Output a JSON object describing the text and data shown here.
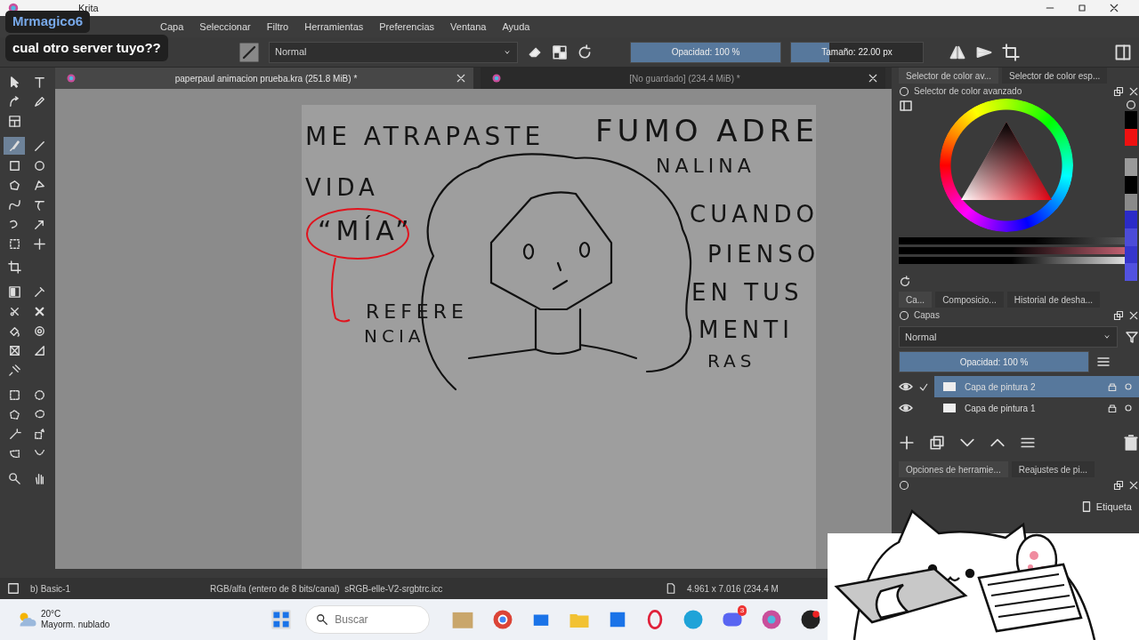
{
  "window": {
    "title": "Krita"
  },
  "chat_overlay": {
    "user": "Mrmagico6",
    "message": "cual otro server tuyo??"
  },
  "menu": [
    "Capa",
    "Seleccionar",
    "Filtro",
    "Herramientas",
    "Preferencias",
    "Ventana",
    "Ayuda"
  ],
  "toolbar": {
    "blend_mode": "Normal",
    "opacity": {
      "label": "Opacidad: 100 %",
      "level": 1
    },
    "size": {
      "label": "Tamaño: 22.00 px",
      "level": 0.29
    }
  },
  "document_tabs": [
    {
      "title": "paperpaul animacion prueba.kra (251.8 MiB) *",
      "selected": true
    },
    {
      "title": "[No guardado] (234.4 MiB) *",
      "selected": false
    }
  ],
  "toolbox": [
    {
      "selected": false
    },
    {
      "selected": false
    },
    {
      "selected": false
    },
    {
      "selected": false
    },
    {
      "selected": false
    },
    {
      "selected": true
    },
    {
      "selected": false
    },
    {
      "selected": false
    },
    {
      "selected": false
    },
    {
      "selected": false
    },
    {
      "selected": false
    },
    {
      "selected": false
    },
    {
      "selected": false
    },
    {
      "selected": false
    },
    {
      "selected": false
    },
    {
      "selected": false
    },
    {
      "selected": false
    },
    {
      "selected": false
    },
    {
      "selected": false
    },
    {
      "selected": false
    },
    {
      "selected": false
    },
    {
      "selected": false
    },
    {
      "selected": false
    },
    {
      "selected": false
    },
    {
      "selected": false
    },
    {
      "selected": false
    },
    {
      "selected": false
    },
    {
      "selected": false
    },
    {
      "selected": false
    },
    {
      "selected": false
    },
    {
      "selected": false
    },
    {
      "selected": false
    },
    {
      "selected": false
    },
    {
      "selected": false
    },
    {
      "selected": false
    },
    {
      "selected": false
    },
    {
      "selected": false
    }
  ],
  "canvas_texts": [
    "ME ATRAPASTE",
    "VIDA",
    "“MÍA”",
    "REFERE",
    "NCIA",
    "FUMO ADRE",
    "NALINA",
    "CUANDO",
    "PIENSO",
    "EN TUS",
    "MENTI",
    "RAS"
  ],
  "dock": {
    "top_tabs": [
      {
        "label": "Selector de color av...",
        "selected": true
      },
      {
        "label": "Selector de color esp...",
        "selected": false
      }
    ],
    "color_docker_title": "Selector de color avanzado",
    "palette": [
      {
        "color": "#000000"
      },
      {
        "color": "#ee1111"
      },
      {
        "color": "#9a9a9a"
      },
      {
        "color": "#000000"
      },
      {
        "color": "#8a8a8a"
      },
      {
        "color": "#2b2bc8"
      },
      {
        "color": "#4c4cd8"
      },
      {
        "color": "#3636cc"
      },
      {
        "color": "#5252e0"
      }
    ],
    "mid_tabs": [
      {
        "label": "Ca...",
        "selected": true
      },
      {
        "label": "Composicio...",
        "selected": false
      },
      {
        "label": "Historial de desha...",
        "selected": false
      }
    ],
    "layers_docker": {
      "title": "Capas",
      "blend_mode": "Normal",
      "opacity": {
        "label": "Opacidad: 100 %",
        "level": 1
      },
      "layers": [
        {
          "name": "Capa de pintura 2",
          "visible": true,
          "selected": true
        },
        {
          "name": "Capa de pintura 1",
          "visible": true,
          "selected": false
        }
      ]
    },
    "bottom_tabs": [
      {
        "label": "Opciones de herramie...",
        "selected": true
      },
      {
        "label": "Reajustes de pi...",
        "selected": false
      }
    ],
    "tag_label": "Etiqueta"
  },
  "status_bar": {
    "brush": "b) Basic-1",
    "color_space": "RGB/alfa (entero de 8 bits/canal)  sRGB-elle-V2-srgbtrc.icc",
    "size": "4.961 x 7.016 (234.4 M"
  },
  "taskbar": {
    "temperature": "20°C",
    "weather": "Mayorm. nublado",
    "search": {
      "placeholder": "Buscar"
    },
    "chat_badge": "3"
  }
}
